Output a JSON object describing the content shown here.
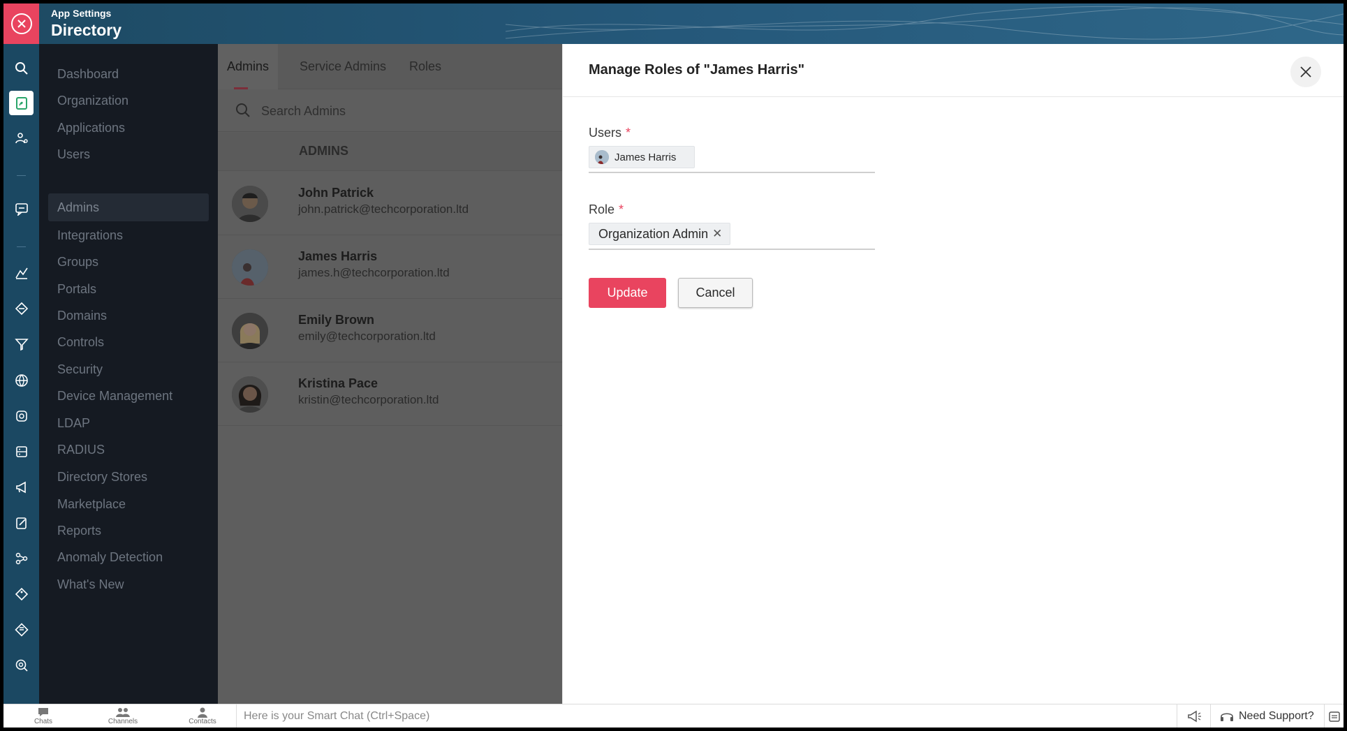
{
  "header": {
    "app_small": "App Settings",
    "app_title": "Directory"
  },
  "sidebar": {
    "items": [
      {
        "label": "Dashboard"
      },
      {
        "label": "Organization"
      },
      {
        "label": "Applications"
      },
      {
        "label": "Users"
      },
      {
        "label": "Admins",
        "active": true
      },
      {
        "label": "Integrations"
      },
      {
        "label": "Groups"
      },
      {
        "label": "Portals"
      },
      {
        "label": "Domains"
      },
      {
        "label": "Controls"
      },
      {
        "label": "Security"
      },
      {
        "label": "Device Management"
      },
      {
        "label": "LDAP"
      },
      {
        "label": "RADIUS"
      },
      {
        "label": "Directory Stores"
      },
      {
        "label": "Marketplace"
      },
      {
        "label": "Reports"
      },
      {
        "label": "Anomaly Detection"
      },
      {
        "label": "What's New"
      }
    ]
  },
  "admins_panel": {
    "tabs": [
      {
        "label": "Admins",
        "active": true
      },
      {
        "label": "Service Admins"
      },
      {
        "label": "Roles"
      }
    ],
    "search_placeholder": "Search Admins",
    "list_header": "ADMINS",
    "admins": [
      {
        "name": "John Patrick",
        "email": "john.patrick@techcorporation.ltd"
      },
      {
        "name": "James Harris",
        "email": "james.h@techcorporation.ltd"
      },
      {
        "name": "Emily Brown",
        "email": "emily@techcorporation.ltd"
      },
      {
        "name": "Kristina Pace",
        "email": "kristin@techcorporation.ltd"
      }
    ]
  },
  "dialog": {
    "title": "Manage Roles of \"James Harris\"",
    "users_label": "Users",
    "users_required": "*",
    "selected_user": "James Harris",
    "role_label": "Role",
    "role_required": "*",
    "selected_role": "Organization Admin",
    "update_label": "Update",
    "cancel_label": "Cancel"
  },
  "bottombar": {
    "chats": "Chats",
    "channels": "Channels",
    "contacts": "Contacts",
    "smartchat_placeholder": "Here is your Smart Chat (Ctrl+Space)",
    "need_support": "Need Support?"
  },
  "colors": {
    "accent": "#e9445f",
    "header": "#1d4a63",
    "sidebar": "#151a22"
  }
}
